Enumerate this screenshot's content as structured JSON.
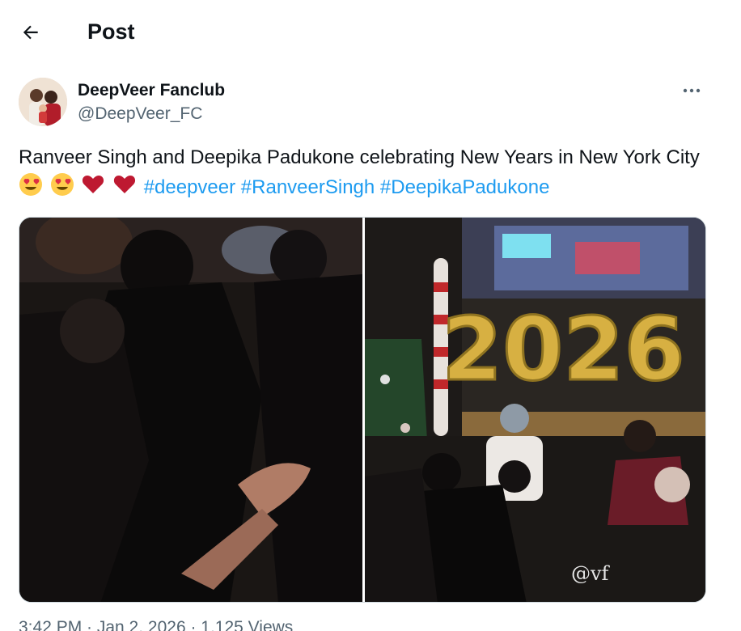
{
  "header": {
    "title": "Post",
    "back_icon": "arrow-left-icon"
  },
  "author": {
    "display_name": "DeepVeer Fanclub",
    "handle": "@DeepVeer_FC",
    "more_icon": "more-horizontal-icon"
  },
  "tweet": {
    "text": "Ranveer Singh and Deepika Padukone celebrating New Years in New York City",
    "emojis": [
      "heart-eyes-emoji",
      "heart-eyes-emoji",
      "red-heart-emoji",
      "red-heart-emoji"
    ],
    "hashtags": [
      "#deepveer",
      "#RanveerSingh",
      "#DeepikaPadukone"
    ]
  },
  "media": {
    "left_image": "party-crowd-photo",
    "right_image": "balloons-2026-photo",
    "balloon_text": "2026",
    "watermark": "@vf"
  },
  "footer": {
    "meta": "3:42 PM · Jan 2, 2026 · 1,125 Views"
  },
  "colors": {
    "link": "#1d9bf0",
    "muted": "#536471",
    "text": "#0f1419"
  }
}
